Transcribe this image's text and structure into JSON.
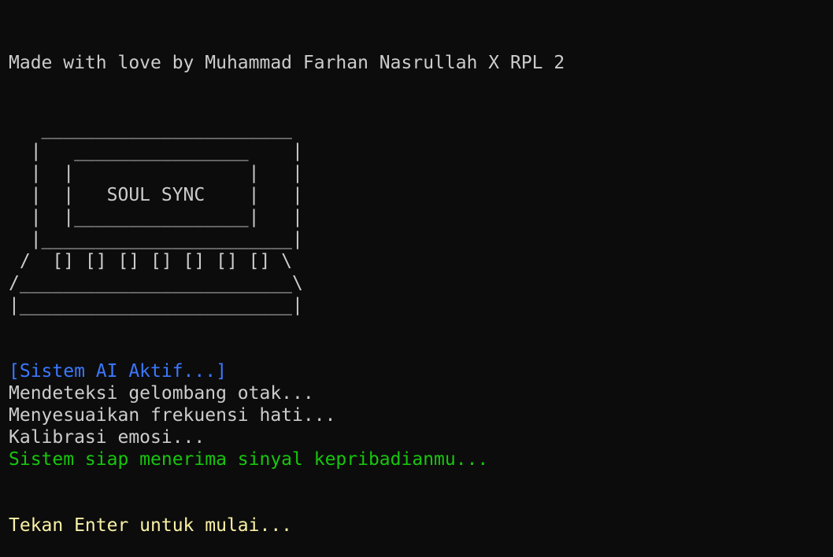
{
  "credit": "Made with love by Muhammad Farhan Nasrullah X RPL 2",
  "ascii_art": "   _______________________\n  |   ________________    |\n  |  |                |   |\n  |  |   SOUL SYNC    |   |\n  |  |________________|   |\n  |_______________________|\n /  [] [] [] [] [] [] [] \\\n/_________________________\\\n|_________________________|",
  "status": {
    "header": "[Sistem AI Aktif...]",
    "lines": [
      "Mendeteksi gelombang otak...",
      "Menyesuaikan frekuensi hati...",
      "Kalibrasi emosi..."
    ],
    "ready": "Sistem siap menerima sinyal kepribadianmu..."
  },
  "prompt": "Tekan Enter untuk mulai...",
  "colors": {
    "background": "#0c0c0c",
    "text": "#cccccc",
    "header": "#3b78ff",
    "ready": "#16c60c",
    "prompt": "#f9f1a5"
  }
}
